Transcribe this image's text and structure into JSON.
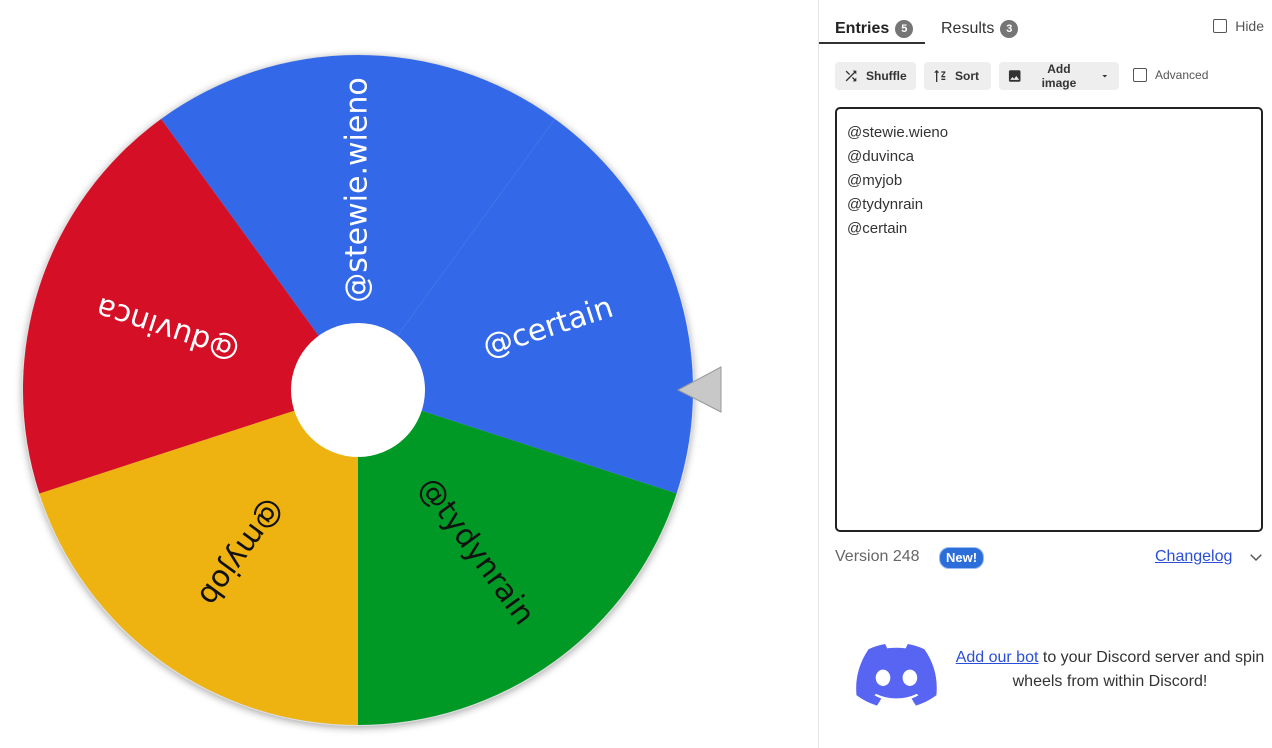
{
  "wheel": {
    "slices": [
      {
        "label": "@stewie.wieno",
        "color": "#3369e8",
        "text_color": "#ffffff"
      },
      {
        "label": "@certain",
        "color": "#3369e8",
        "text_color": "#ffffff"
      },
      {
        "label": "@tydynrain",
        "color": "#009925",
        "text_color": "#111111"
      },
      {
        "label": "@myjob",
        "color": "#eeb211",
        "text_color": "#111111"
      },
      {
        "label": "@duvinca",
        "color": "#d50f25",
        "text_color": "#ffffff"
      }
    ],
    "pointer_color": "#c8c8c8"
  },
  "tabs": {
    "entries": {
      "label": "Entries",
      "count": "5"
    },
    "results": {
      "label": "Results",
      "count": "3"
    }
  },
  "hide": {
    "label": "Hide"
  },
  "toolbar": {
    "shuffle": {
      "label": "Shuffle",
      "icon": "shuffle-icon"
    },
    "sort": {
      "label": "Sort",
      "icon": "sort-icon"
    },
    "add_image": {
      "label": "Add image",
      "icon": "image-icon"
    },
    "advanced": {
      "label": "Advanced"
    }
  },
  "entries": [
    "@stewie.wieno",
    "@duvinca",
    "@myjob",
    "@tydynrain",
    "@certain"
  ],
  "footer": {
    "version": "Version 248",
    "new_badge": "New!",
    "changelog": "Changelog"
  },
  "discord": {
    "link_text": "Add our bot",
    "text": " to your Discord server and spin wheels from within Discord!",
    "color": "#5865f2"
  }
}
